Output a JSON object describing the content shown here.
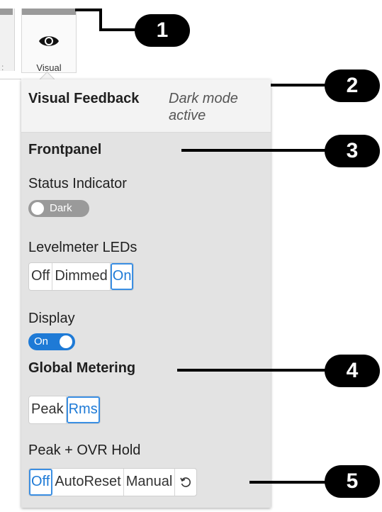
{
  "tab": {
    "label": "Visual",
    "icon": "eye-icon"
  },
  "panel": {
    "header": {
      "title": "Visual Feedback",
      "status_line1": "Dark mode",
      "status_line2": "active"
    },
    "section_frontpanel": "Frontpanel",
    "status_indicator": {
      "label": "Status Indicator",
      "toggle_text": "Dark",
      "state": "off"
    },
    "levelmeter": {
      "label": "Levelmeter LEDs",
      "options": [
        "Off",
        "Dimmed",
        "On"
      ],
      "selected": "On"
    },
    "display": {
      "label": "Display",
      "toggle_text": "On",
      "state": "on"
    },
    "section_global_metering": "Global Metering",
    "metering": {
      "options": [
        "Peak",
        "Rms"
      ],
      "selected": "Rms"
    },
    "peak_ovr_hold": {
      "label": "Peak + OVR Hold",
      "options": [
        "Off",
        "AutoReset",
        "Manual"
      ],
      "selected": "Off",
      "reset_icon": "reset-icon"
    }
  },
  "callouts": [
    "1",
    "2",
    "3",
    "4",
    "5"
  ],
  "colors": {
    "accent": "#1e7ad6",
    "panel_bg": "#e3e3e3",
    "toggle_off": "#9a9a9a"
  }
}
